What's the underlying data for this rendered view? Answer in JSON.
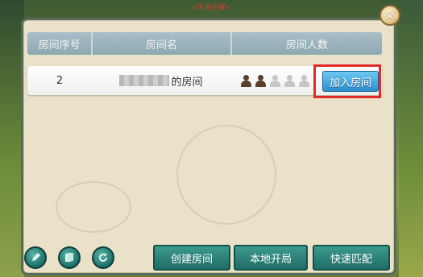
{
  "top_banner": "«天池巨蜥»",
  "close_label": "×",
  "table": {
    "headers": [
      "房间序号",
      "房间名",
      "房间人数"
    ],
    "rows": [
      {
        "number": "2",
        "name_suffix": "的房间",
        "occupants_filled": 2,
        "capacity": 5,
        "join_label": "加入房间"
      }
    ]
  },
  "bottom_bar": {
    "create_label": "创建房间",
    "local_label": "本地开局",
    "quick_label": "快速匹配"
  },
  "icons": [
    "pen-icon",
    "card-icon",
    "refresh-icon"
  ],
  "colors": {
    "accent_blue": "#2a8fd0",
    "highlight_red": "#e02a2a",
    "teal": "#1f6c66"
  }
}
